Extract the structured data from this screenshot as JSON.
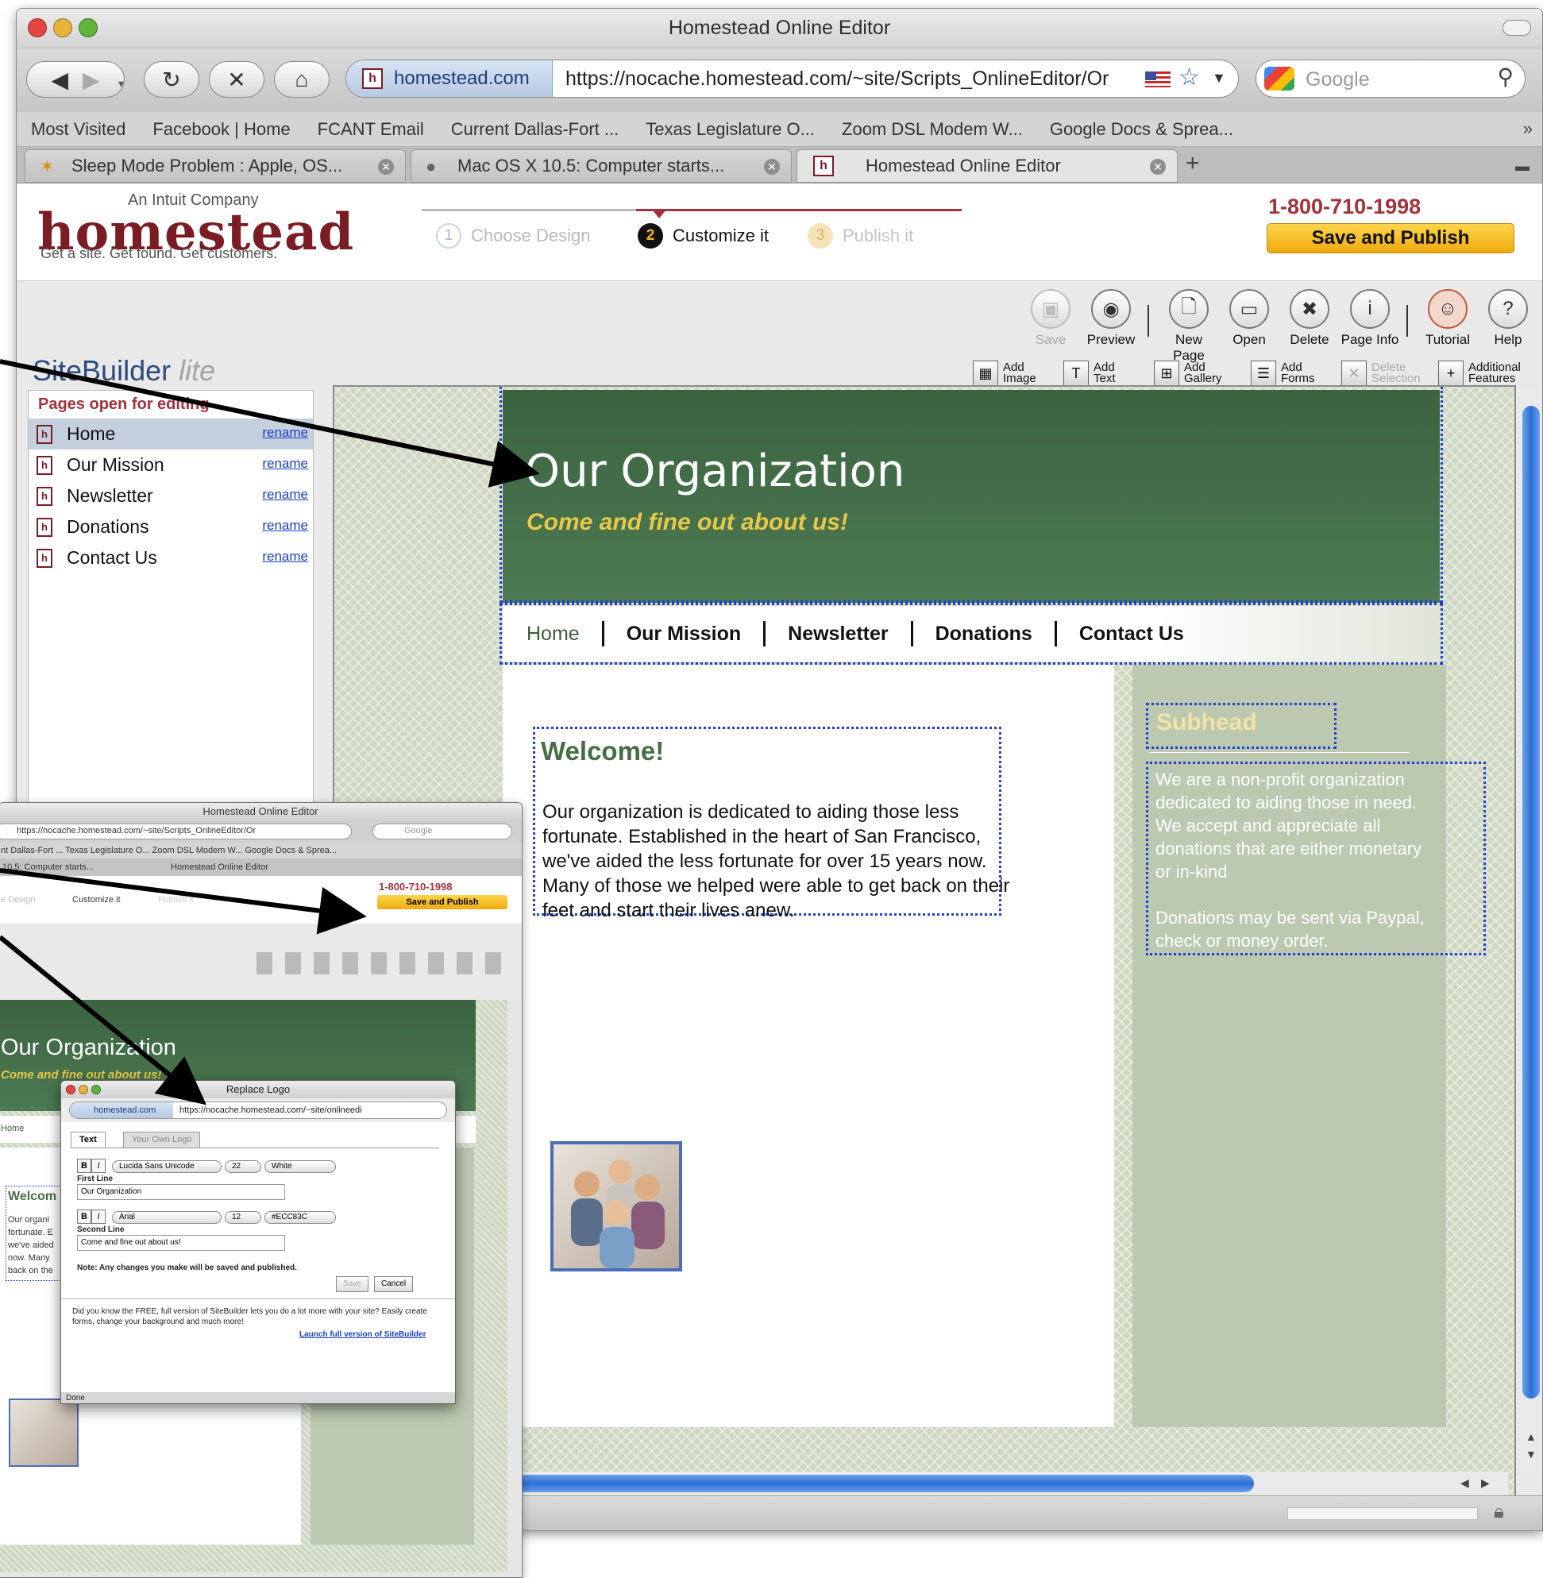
{
  "window": {
    "title": "Homestead Online Editor"
  },
  "browser": {
    "site_identity": "homestead.com",
    "url": "https://nocache.homestead.com/~site/Scripts_OnlineEditor/Or",
    "search_placeholder": "Google",
    "bookmarks": [
      "Most Visited",
      "Facebook | Home",
      "FCANT Email",
      "Current Dallas-Fort ...",
      "Texas Legislature O...",
      "Zoom DSL Modem W...",
      "Google Docs & Sprea..."
    ],
    "tabs": [
      {
        "label": "Sleep Mode Problem : Apple, OS..."
      },
      {
        "label": "Mac OS X 10.5: Computer starts..."
      },
      {
        "label": "Homestead Online Editor"
      }
    ]
  },
  "header": {
    "logo_small": "An Intuit Company",
    "logo_big": "homestead",
    "logo_tagline": "Get a site. Get found. Get customers.",
    "steps": [
      {
        "num": "1",
        "label": "Choose Design"
      },
      {
        "num": "2",
        "label": "Customize it"
      },
      {
        "num": "3",
        "label": "Publish it"
      }
    ],
    "phone": "1-800-710-1998",
    "save_publish": "Save and Publish"
  },
  "toolbar": {
    "app_name": "SiteBuilder",
    "app_suffix": "lite",
    "tools": [
      "Save",
      "Preview",
      "New Page",
      "Open",
      "Delete",
      "Page Info",
      "Tutorial",
      "Help"
    ],
    "add_tools": [
      {
        "l1": "Add",
        "l2": "Image"
      },
      {
        "l1": "Add",
        "l2": "Text"
      },
      {
        "l1": "Add",
        "l2": "Gallery"
      },
      {
        "l1": "Add",
        "l2": "Forms"
      },
      {
        "l1": "Delete",
        "l2": "Selection"
      },
      {
        "l1": "Additional",
        "l2": "Features"
      }
    ]
  },
  "pages_panel": {
    "title": "Pages open for editing",
    "rename_label": "rename",
    "pages": [
      "Home",
      "Our Mission",
      "Newsletter",
      "Donations",
      "Contact Us"
    ]
  },
  "site": {
    "title": "Our Organization",
    "subtitle": "Come and fine out about us!",
    "nav": [
      "Home",
      "Our Mission",
      "Newsletter",
      "Donations",
      "Contact Us"
    ],
    "welcome": "Welcome!",
    "body": "Our organization is dedicated to aiding those less fortunate. Established in the heart of San Francisco, we've aided the less fortunate for over 15 years now. Many of those we helped were able to get back on their feet and start their lives anew.",
    "subhead": "Subhead",
    "side_p1": "We are a non-profit organization dedicated to aiding those in need. We accept and appreciate all donations that are either monetary or in-kind",
    "side_p2": "Donations may be sent via Paypal, check or money order."
  },
  "thumb_window": {
    "title": "Homestead Online Editor",
    "url": "https://nocache.homestead.com/~site/Scripts_OnlineEditor/Or",
    "search": "Google",
    "bookmarks": "nt Dallas-Fort ...     Texas Legislature O...     Zoom DSL Modem W...     Google Docs & Sprea...",
    "tab1": "10.5: Computer starts...",
    "tab2": "Homestead Online Editor",
    "phone": "1-800-710-1998",
    "save_publish": "Save and Publish",
    "step1": "e Design",
    "step2": "Customize it",
    "step3": "Publish it",
    "org_title": "Our Organization",
    "org_sub": "Come and fine out about us!",
    "nav_home": "Home",
    "welcome": "Welcom",
    "body_lines": [
      "Our organi",
      "fortunate. E",
      "we've aided",
      "now. Many",
      "back on the"
    ]
  },
  "dialog": {
    "title": "Replace Logo",
    "site_identity": "homestead.com",
    "url": "https://nocache.homestead.com/~site/onlineedi",
    "tab_text": "Text",
    "tab_logo": "Your Own Logo",
    "font1": "Lucida Sans Unicode",
    "size1": "22",
    "color1": "White",
    "label1": "First Line",
    "value1": "Our Organization",
    "font2": "Arial",
    "size2": "12",
    "color2": "#ECC83C",
    "label2": "Second Line",
    "value2": "Come and fine out about us!",
    "note": "Note: Any changes you make will be saved and published.",
    "save": "Save",
    "cancel": "Cancel",
    "promo": "Did you know the FREE, full version of SiteBuilder lets you do a lot more with your site? Easily create forms, change your background and much more!",
    "launch": "Launch full version of SiteBuilder",
    "status": "Done"
  },
  "colors": {
    "brand": "#7a1c24",
    "header_green": "#466e45",
    "subtitle_gold": "#e7c84a",
    "selection_blue": "#1f3fd6",
    "save_publish_yellow": "#f2b817"
  }
}
